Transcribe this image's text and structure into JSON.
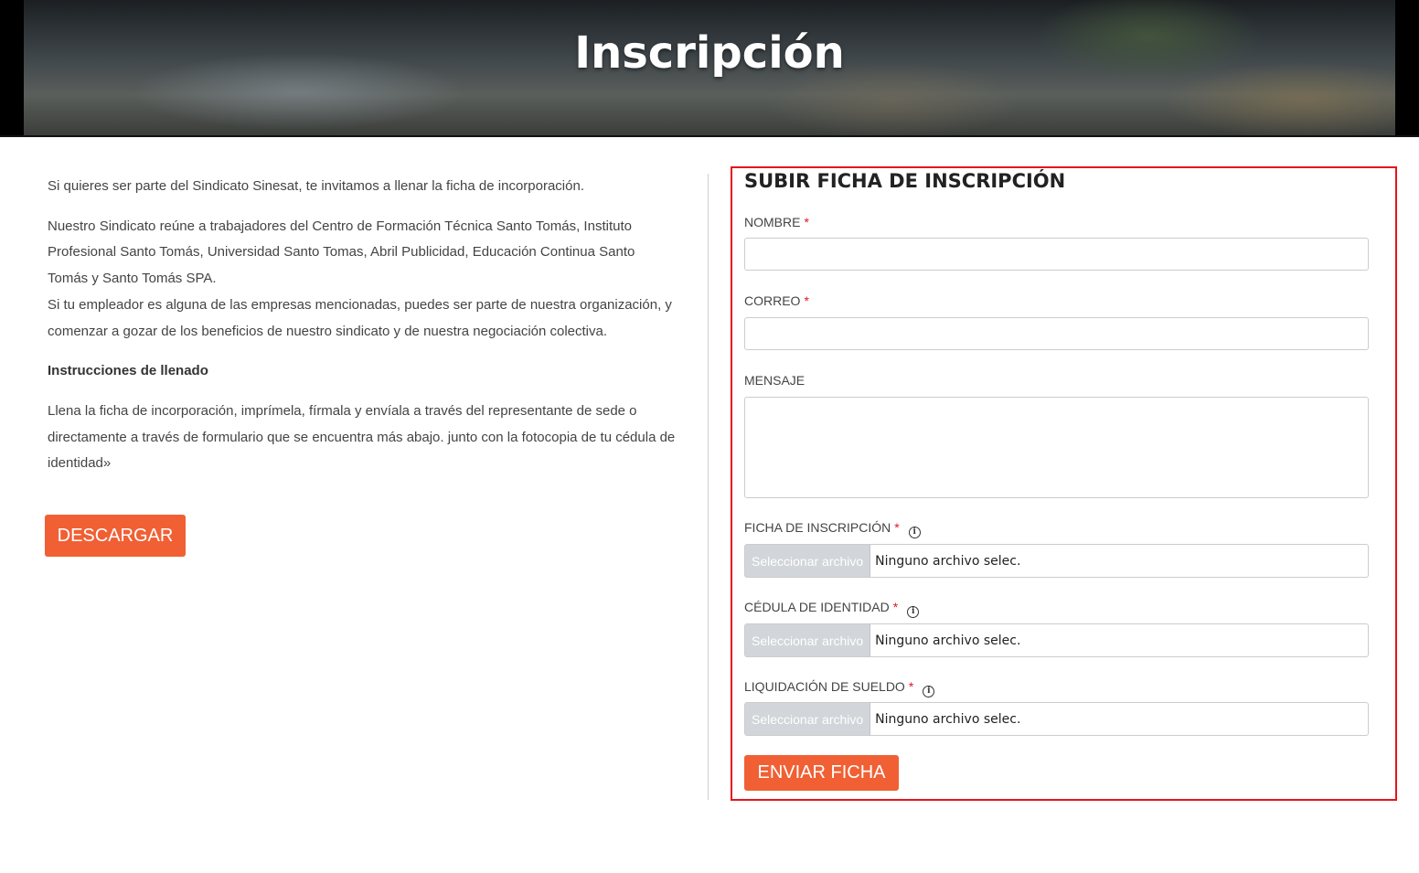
{
  "hero": {
    "title": "Inscripción"
  },
  "intro": {
    "p1": "Si quieres ser parte del Sindicato Sinesat, te invitamos a llenar la ficha de incorporación.",
    "p2a": "Nuestro Sindicato reúne a trabajadores del Centro de Formación Técnica Santo Tomás, Instituto Profesional Santo Tomás, Universidad Santo Tomas, Abril Publicidad, Educación Continua Santo Tomás y Santo Tomás SPA.",
    "p2b": "Si tu empleador es alguna de las empresas mencionadas, puedes ser parte de nuestra organización, y comenzar a gozar de los beneficios de nuestro sindicato y de nuestra negociación colectiva.",
    "instructions_heading": "Instrucciones de llenado",
    "p3": "Llena la ficha de incorporación, imprímela, fírmala y envíala a través del representante de sede o directamente a través de formulario que se encuentra más abajo. junto con la fotocopia de tu cédula de identidad»",
    "download_label": "DESCARGAR"
  },
  "form": {
    "title": "SUBIR FICHA DE INSCRIPCIÓN",
    "required_mark": "*",
    "info_glyph": "i",
    "name_label": "NOMBRE",
    "name_value": "",
    "email_label": "CORREO",
    "email_value": "",
    "message_label": "MENSAJE",
    "message_value": "",
    "file_button_label": "Seleccionar archivo",
    "file_status": "Ninguno archivo selec.",
    "ficha_label": "FICHA DE INSCRIPCIÓN",
    "cedula_label": "CÉDULA DE IDENTIDAD",
    "liquidacion_label": "LIQUIDACIÓN DE SUELDO",
    "submit_label": "ENVIAR FICHA"
  },
  "colors": {
    "accent": "#f06034",
    "required": "#e5141c",
    "highlight_border": "#e5141c"
  }
}
